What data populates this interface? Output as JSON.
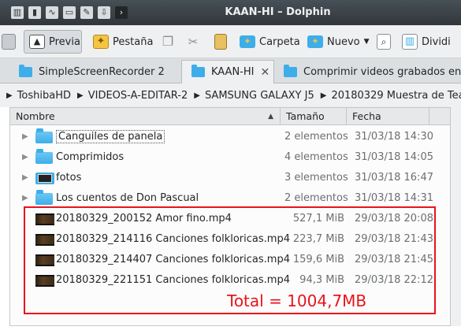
{
  "window": {
    "title": "KAAN-HI – Dolphin"
  },
  "toolbar": {
    "preview_label": "Previa",
    "tab_label": "Pestaña",
    "folder_label": "Carpeta",
    "new_label": "Nuevo",
    "split_label": "Dividi"
  },
  "tabs": [
    {
      "label": "SimpleScreenRecorder 2"
    },
    {
      "label": "KAAN-HI"
    },
    {
      "label": "Comprimir videos grabados en"
    }
  ],
  "breadcrumb": [
    "ToshibaHD",
    "VIDEOS-A-EDITAR-2",
    "SAMSUNG GALAXY J5",
    "20180329 Muestra de Tea"
  ],
  "columns": {
    "name": "Nombre",
    "size": "Tamaño",
    "date": "Fecha"
  },
  "folders": [
    {
      "name": "Canguiles de panela",
      "size": "2 elementos",
      "date": "31/03/18 14:30"
    },
    {
      "name": "Comprimidos",
      "size": "4 elementos",
      "date": "31/03/18 14:05"
    },
    {
      "name": "fotos",
      "size": "3 elementos",
      "date": "31/03/18 16:47"
    },
    {
      "name": "Los cuentos de Don Pascual",
      "size": "2 elementos",
      "date": "31/03/18 14:31"
    }
  ],
  "files": [
    {
      "name": "20180329_200152 Amor fino.mp4",
      "size": "527,1 MiB",
      "date": "29/03/18 20:08"
    },
    {
      "name": "20180329_214116 Canciones folkloricas.mp4",
      "size": "223,7 MiB",
      "date": "29/03/18 21:43"
    },
    {
      "name": "20180329_214407 Canciones folkloricas.mp4",
      "size": "159,6 MiB",
      "date": "29/03/18 21:45"
    },
    {
      "name": "20180329_221151 Canciones folkloricas.mp4",
      "size": "94,3 MiB",
      "date": "29/03/18 22:12"
    }
  ],
  "annotation": {
    "total": "Total = 1004,7MB",
    "color": "#e8141c"
  },
  "colors": {
    "accent": "#3daee9",
    "titlebar": "#31363b"
  }
}
